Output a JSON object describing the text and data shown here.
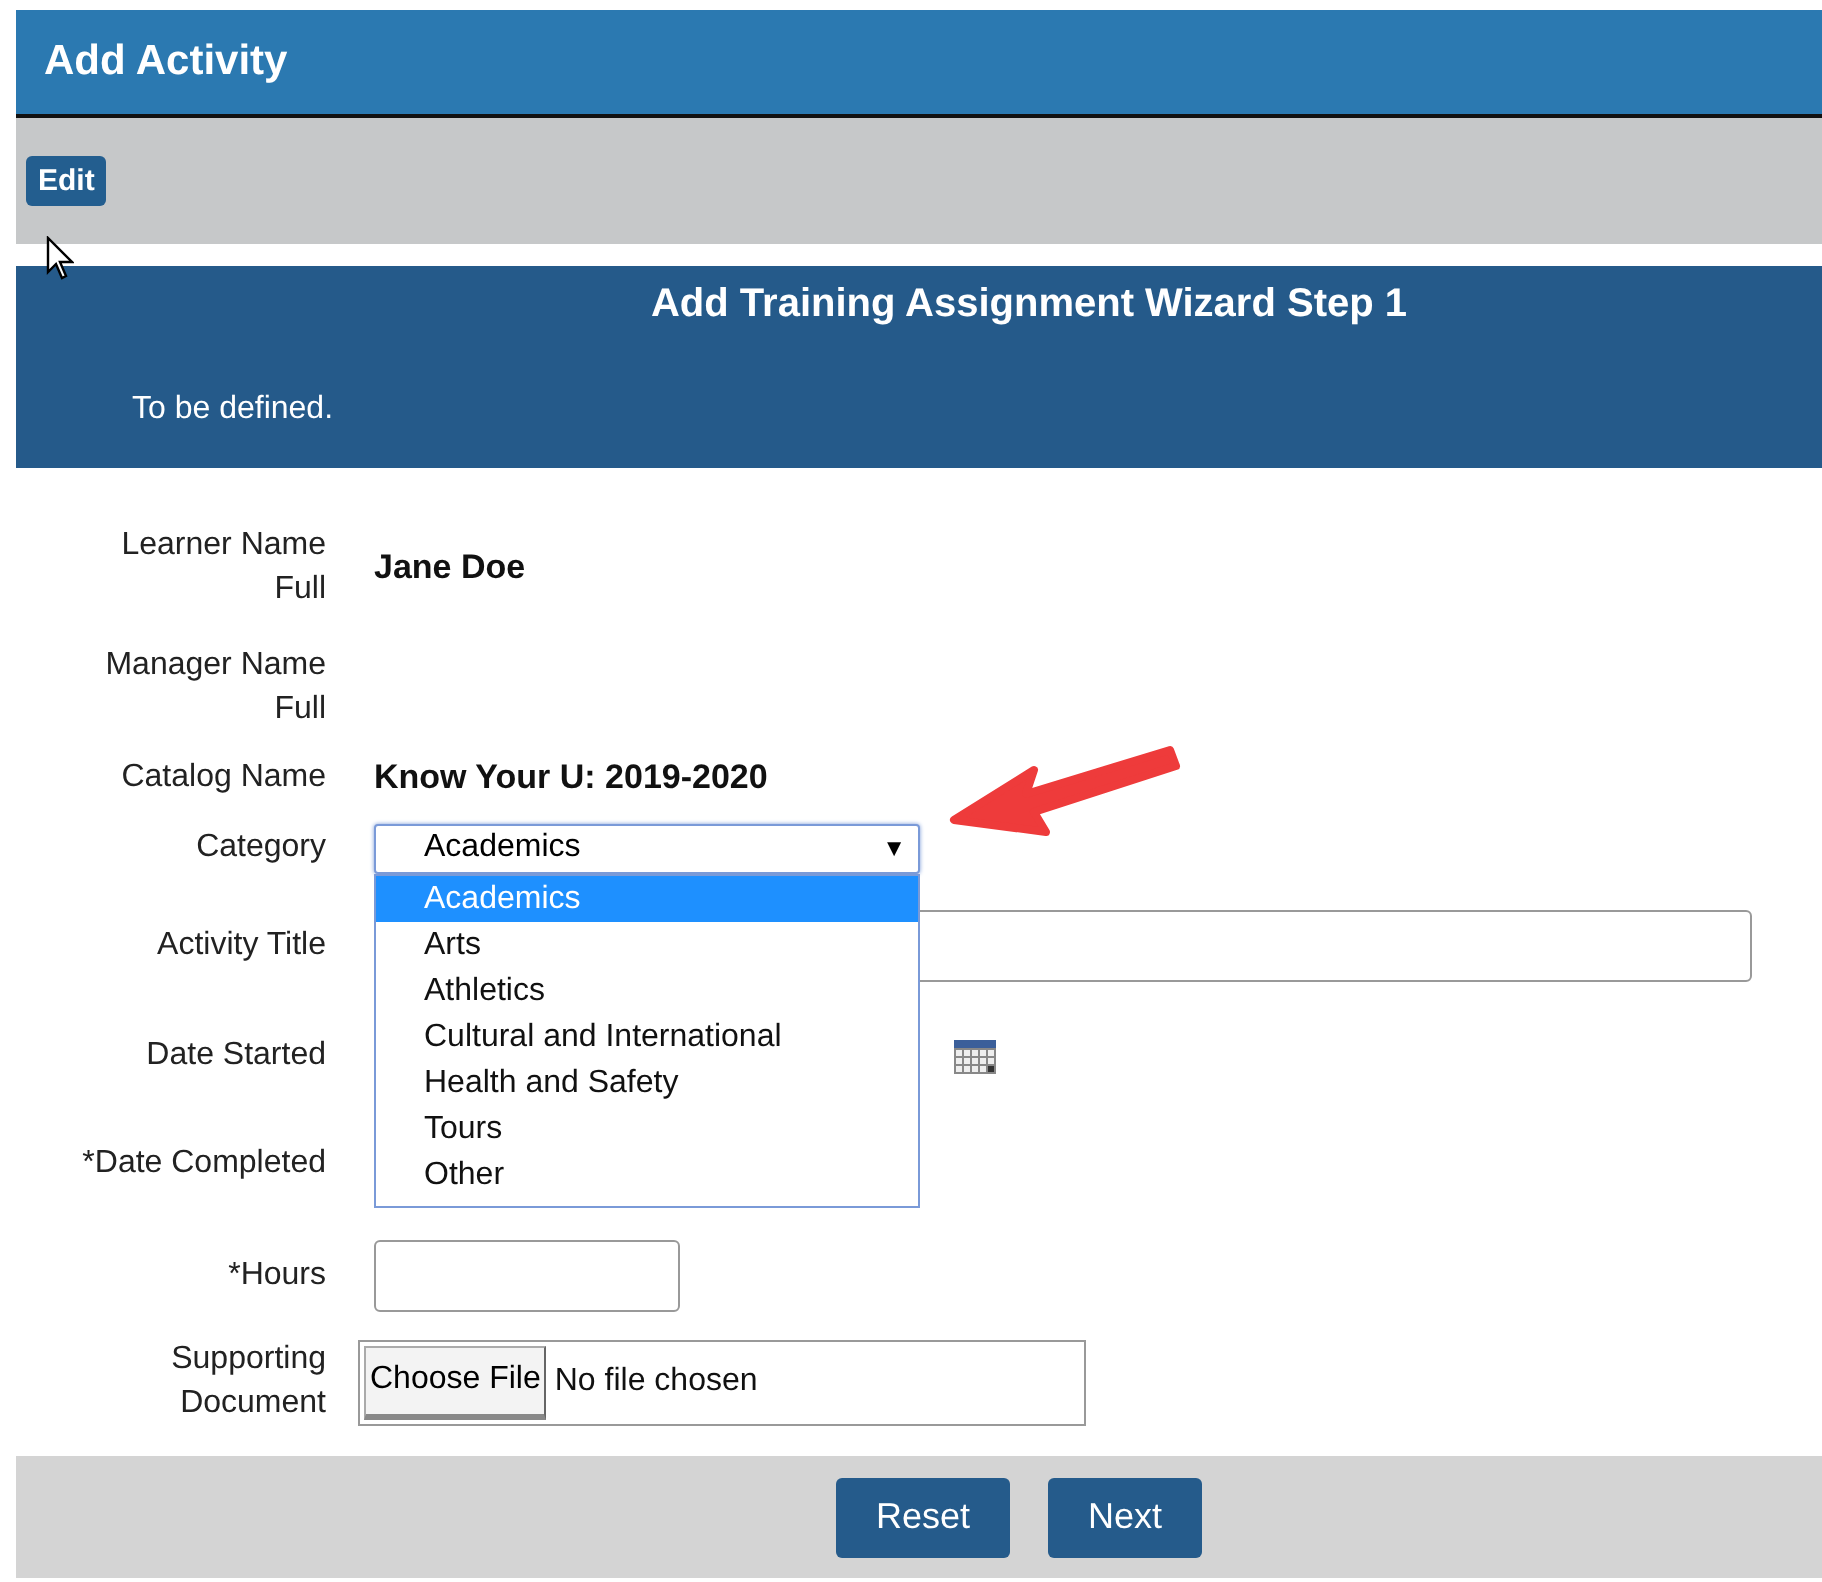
{
  "title": "Add Activity",
  "toolbar": {
    "buttons": [
      "Edit"
    ]
  },
  "wizard": {
    "title": "Add Training Assignment Wizard Step 1",
    "description": "To be defined."
  },
  "fields": [
    {
      "kind": "static",
      "label": "Learner Name\nFull",
      "value": "Jane Doe"
    },
    {
      "kind": "static",
      "label": "Manager Name\nFull"
    },
    {
      "kind": "static",
      "label": "Catalog Name",
      "value": "Know Your U: 2019-2020"
    },
    {
      "kind": "select",
      "label": "Category",
      "value": "Academics",
      "caret": "▼",
      "expanded": true,
      "options": [
        {
          "label": "Academics",
          "selected": true
        },
        {
          "label": "Arts",
          "selected": false
        },
        {
          "label": "Athletics",
          "selected": false
        },
        {
          "label": "Cultural and International",
          "selected": false
        },
        {
          "label": "Health and Safety",
          "selected": false
        },
        {
          "label": "Tours",
          "selected": false
        },
        {
          "label": "Other",
          "selected": false
        }
      ]
    },
    {
      "kind": "text",
      "label": "Activity Title"
    },
    {
      "kind": "date",
      "label": "Date Started",
      "calendar": true
    },
    {
      "kind": "date",
      "label": "*Date Completed"
    },
    {
      "kind": "number",
      "label": "*Hours"
    },
    {
      "kind": "file",
      "label": "Supporting\nDocument",
      "button": "Choose File",
      "status": "No file chosen"
    }
  ],
  "actions": [
    "Reset",
    "Next"
  ]
}
